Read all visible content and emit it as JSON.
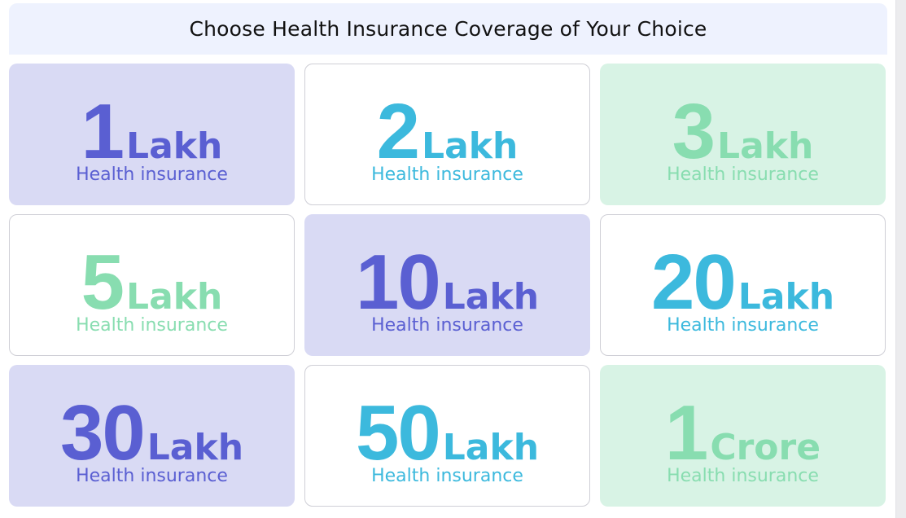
{
  "header": {
    "title": "Choose Health Insurance Coverage of Your Choice"
  },
  "colors": {
    "lavender_bg": "#d9daf4",
    "mint_bg": "#d8f3e5",
    "white_bg": "#ffffff",
    "indigo_text": "#5a5fd2",
    "sky_text": "#3cb9dd",
    "mint_text": "#88ddb0"
  },
  "cards": [
    {
      "amount": "1",
      "unit": "Lakh",
      "subtitle": "Health insurance"
    },
    {
      "amount": "2",
      "unit": "Lakh",
      "subtitle": "Health insurance"
    },
    {
      "amount": "3",
      "unit": "Lakh",
      "subtitle": "Health insurance"
    },
    {
      "amount": "5",
      "unit": "Lakh",
      "subtitle": "Health insurance"
    },
    {
      "amount": "10",
      "unit": "Lakh",
      "subtitle": "Health insurance"
    },
    {
      "amount": "20",
      "unit": "Lakh",
      "subtitle": "Health insurance"
    },
    {
      "amount": "30",
      "unit": "Lakh",
      "subtitle": "Health insurance"
    },
    {
      "amount": "50",
      "unit": "Lakh",
      "subtitle": "Health insurance"
    },
    {
      "amount": "1",
      "unit": "Crore",
      "subtitle": "Health insurance"
    }
  ]
}
